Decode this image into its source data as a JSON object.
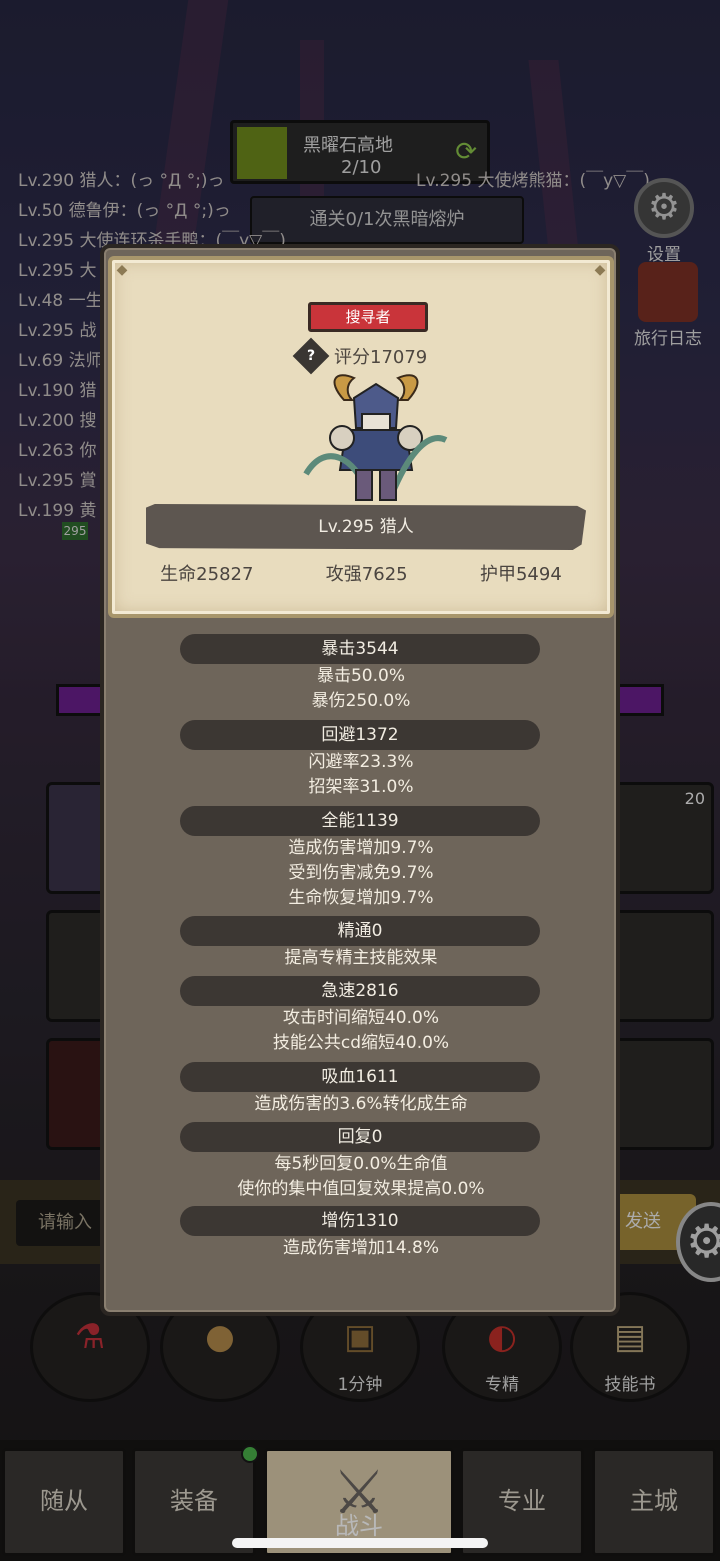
{
  "background": {
    "zone": {
      "name": "黑曜石高地",
      "progress": "2/10"
    },
    "quest": "通关0/1次黑暗熔炉",
    "chat": [
      "Lv.290 猎人：(っ °Д °;)っ",
      "Lv.50 德鲁伊：(っ °Д °;)っ",
      "Lv.295 大使连环杀手鸭：(￣y▽￣)",
      "Lv.295 大",
      "Lv.48 一生",
      "Lv.295 战",
      "Lv.69 法师",
      "Lv.190 猎",
      "Lv.200 搜",
      "Lv.263 你",
      "Lv.295 賞",
      "Lv.199 黄"
    ],
    "chat_right": "Lv.295 大使烤熊猫：(￣y▽￣)",
    "settings_label": "设置",
    "journal_label": "旅行日志",
    "slot_count": "20",
    "level_badge": "295",
    "input_placeholder": "请输入",
    "send_label": "发送",
    "actions": [
      {
        "label": "",
        "icon": "potion-icon"
      },
      {
        "label": "",
        "icon": "bread-icon"
      },
      {
        "label": "1分钟",
        "icon": "chest-icon"
      },
      {
        "label": "专精",
        "icon": "spec-icon"
      },
      {
        "label": "技能书",
        "icon": "book-icon"
      }
    ]
  },
  "nav": {
    "tabs": [
      {
        "label": "随从"
      },
      {
        "label": "装备"
      },
      {
        "label": "战斗"
      },
      {
        "label": "专业"
      },
      {
        "label": "主城"
      }
    ]
  },
  "modal": {
    "class_badge": "搜寻者",
    "score": "评分17079",
    "name": "Lv.295 猎人",
    "stats": {
      "hp": "生命25827",
      "atk": "攻强7625",
      "armor": "护甲5494"
    },
    "sections": [
      {
        "header": "暴击3544",
        "lines": [
          "暴击50.0%",
          "暴伤250.0%"
        ]
      },
      {
        "header": "回避1372",
        "lines": [
          "闪避率23.3%",
          "招架率31.0%"
        ]
      },
      {
        "header": "全能1139",
        "lines": [
          "造成伤害增加9.7%",
          "受到伤害减免9.7%",
          "生命恢复增加9.7%"
        ]
      },
      {
        "header": "精通0",
        "lines": [
          "提高专精主技能效果"
        ]
      },
      {
        "header": "急速2816",
        "lines": [
          "攻击时间缩短40.0%",
          "技能公共cd缩短40.0%"
        ]
      },
      {
        "header": "吸血1611",
        "lines": [
          "造成伤害的3.6%转化成生命"
        ]
      },
      {
        "header": "回复0",
        "lines": [
          "每5秒回复0.0%生命值",
          "使你的集中值回复效果提高0.0%"
        ]
      },
      {
        "header": "增伤1310",
        "lines": [
          "造成伤害增加14.8%"
        ]
      }
    ]
  },
  "colors": {
    "badge_red": "#c9343a",
    "card_parchment": "#e8dcbe",
    "modal_body": "#6e655a",
    "section_header": "#3c3733"
  }
}
